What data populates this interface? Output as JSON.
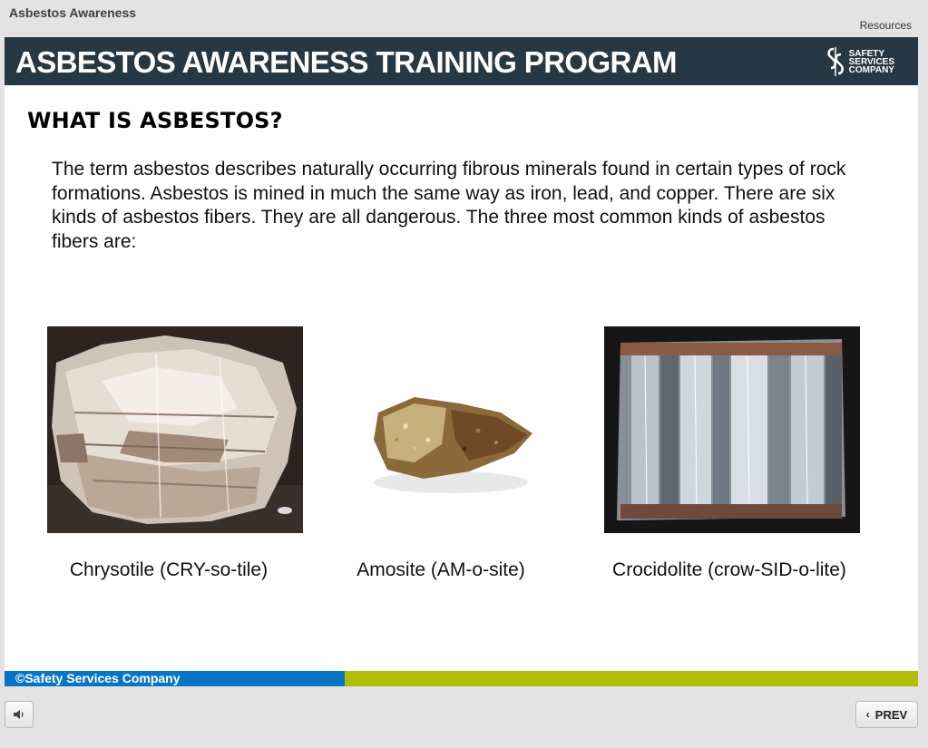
{
  "app": {
    "title": "Asbestos Awareness",
    "resources_label": "Resources"
  },
  "banner": {
    "title": "ASBESTOS AWARENESS TRAINING PROGRAM",
    "logo_lines": [
      "SAFETY",
      "SERVICES",
      "COMPANY"
    ]
  },
  "slide": {
    "heading": "WHAT IS ASBESTOS?",
    "body": "The term asbestos describes naturally occurring fibrous minerals found in certain types of rock formations.  Asbestos is mined in much the same way as iron, lead, and copper.  There are six kinds of asbestos fibers. They are all dangerous. The three most common kinds of asbestos fibers are:",
    "minerals": [
      {
        "caption": "Chrysotile (CRY-so-tile)"
      },
      {
        "caption": "Amosite (AM-o-site)"
      },
      {
        "caption": "Crocidolite (crow-SID-o-lite)"
      }
    ],
    "copyright": "©Safety Services Company"
  },
  "controls": {
    "prev_label": "PREV"
  },
  "colors": {
    "banner": "#263843",
    "footer_blue": "#0874c6",
    "footer_green": "#b1bd02"
  },
  "icons": {
    "volume": "volume-icon",
    "prev": "chevron-left-icon",
    "logo": "safety-services-logo"
  }
}
